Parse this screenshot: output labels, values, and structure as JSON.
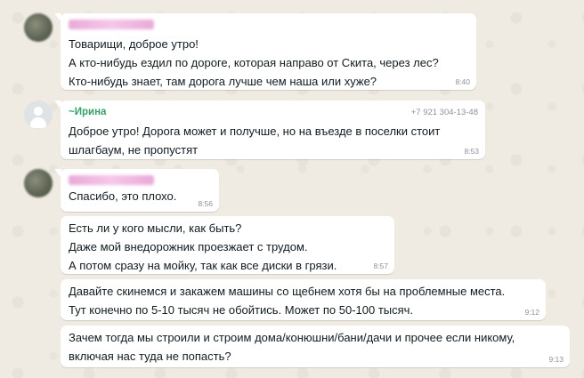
{
  "messages": [
    {
      "sender": "",
      "avatar": "blurred",
      "lines": [
        "Товарищи, доброе утро!",
        "А кто-нибудь ездил по дороге, которая направо от Скита, через лес?",
        "Кто-нибудь знает, там дорога лучше чем наша или хуже?"
      ],
      "time": "8:40"
    },
    {
      "sender": "~Ирина",
      "phone": "+7 921 304-13-48",
      "avatar": "default",
      "lines": [
        "Доброе утро! Дорога может и получше, но на въезде в поселки стоит",
        "шлагбаум, не пропустят"
      ],
      "time": "8:53"
    },
    {
      "sender": "",
      "avatar": "blurred",
      "lines": [
        "Спасибо, это плохо."
      ],
      "time": "8:56"
    },
    {
      "lines": [
        "Есть ли у кого мысли, как быть?",
        "Даже мой внедорожник проезжает с трудом.",
        "А потом сразу на мойку, так как все диски в грязи."
      ],
      "time": "8:57"
    },
    {
      "lines": [
        "Давайте скинемся и закажем машины со щебнем хотя бы на проблемные места.",
        "Тут конечно по 5-10 тысяч не обойтись. Может по 50-100 тысяч."
      ],
      "time": "9:12"
    },
    {
      "lines": [
        "Зачем тогда мы строили и строим дома/конюшни/бани/дачи и прочее если никому,",
        "включая нас туда не попасть?"
      ],
      "time": "9:13"
    }
  ]
}
